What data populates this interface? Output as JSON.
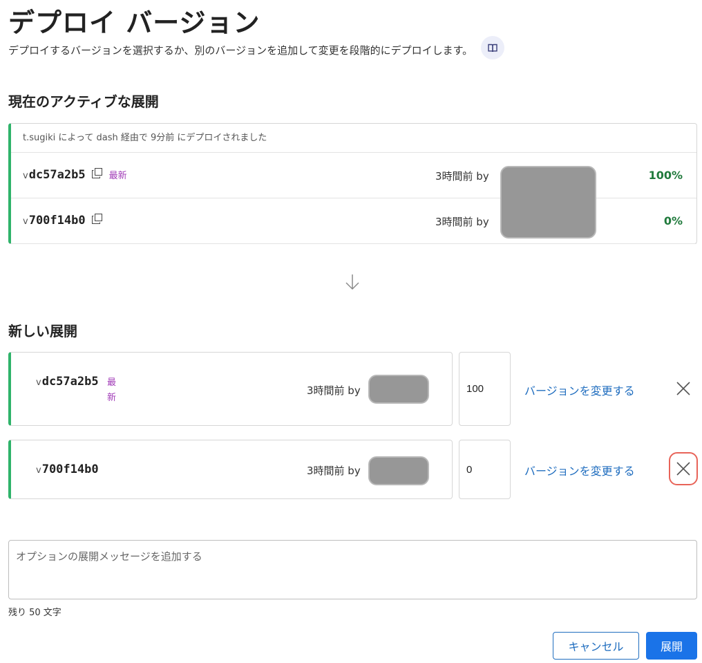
{
  "header": {
    "title": "デプロイ バージョン",
    "subtitle": "デプロイするバージョンを選択するか、別のバージョンを追加して変更を段階的にデプロイします。",
    "doc_icon": "book-icon"
  },
  "active": {
    "section_title": "現在のアクティブな展開",
    "caption": "t.sugiki によって dash 経由で 9分前 にデプロイされました",
    "versions": [
      {
        "prefix": "v",
        "id": "dc57a2b5",
        "latest_label": "最新",
        "time_by": "3時間前 by",
        "percent": "100%"
      },
      {
        "prefix": "v",
        "id": "700f14b0",
        "latest_label": "",
        "time_by": "3時間前 by",
        "percent": "0%"
      }
    ]
  },
  "new": {
    "section_title": "新しい展開",
    "versions": [
      {
        "prefix": "v",
        "id": "dc57a2b5",
        "latest_label": "最新",
        "time_by": "3時間前 by",
        "percent_value": "100",
        "change_label": "バージョンを変更する"
      },
      {
        "prefix": "v",
        "id": "700f14b0",
        "latest_label": "",
        "time_by": "3時間前 by",
        "percent_value": "0",
        "change_label": "バージョンを変更する"
      }
    ]
  },
  "message": {
    "placeholder": "オプションの展開メッセージを追加する",
    "remaining": "残り 50 文字"
  },
  "actions": {
    "cancel_label": "キャンセル",
    "deploy_label": "展開"
  },
  "colors": {
    "accent_green": "#2fb36a",
    "percent_green": "#207a3c",
    "link_blue": "#1f6dbf",
    "primary_blue": "#1a73e8",
    "latest_purple": "#a23db8",
    "focus_red": "#e86358"
  }
}
